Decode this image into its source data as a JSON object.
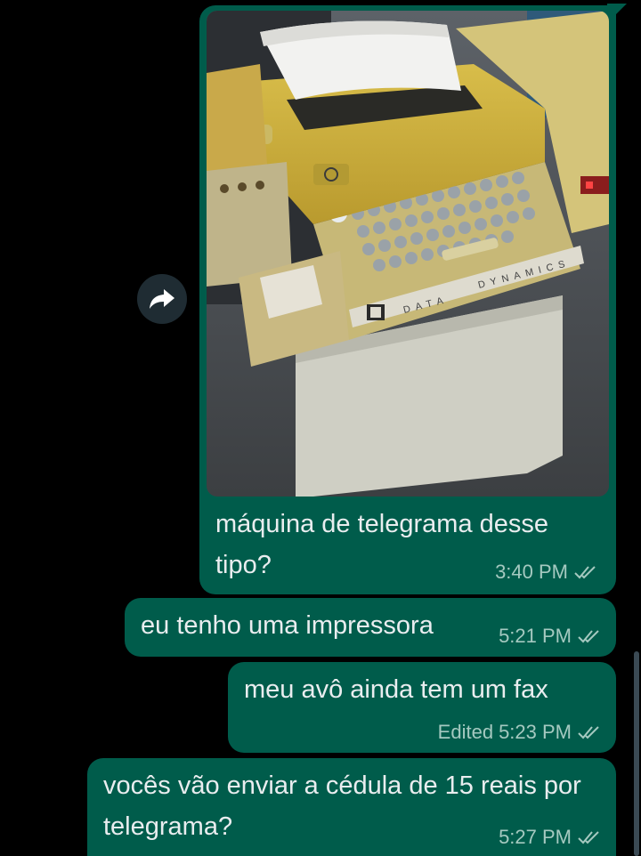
{
  "messages": [
    {
      "text": "máquina de telegrama desse tipo?",
      "time": "3:40 PM",
      "edited": "",
      "has_image": true,
      "image_labels": [
        "DATA",
        "DYNAMICS"
      ]
    },
    {
      "text": "eu tenho uma impressora",
      "time": "5:21 PM",
      "edited": ""
    },
    {
      "text": "meu avô ainda tem um fax",
      "time": "5:23 PM",
      "edited": "Edited"
    },
    {
      "text": "vocês vão enviar a cédula de 15 reais por telegrama?",
      "time": "5:27 PM",
      "edited": ""
    }
  ],
  "icons": {
    "forward": "forward-icon",
    "read_receipt": "double-check-icon"
  },
  "colors": {
    "background": "#000000",
    "outgoing_bubble": "#005c4b",
    "text": "#e9edef",
    "meta": "#a5c9c0"
  }
}
